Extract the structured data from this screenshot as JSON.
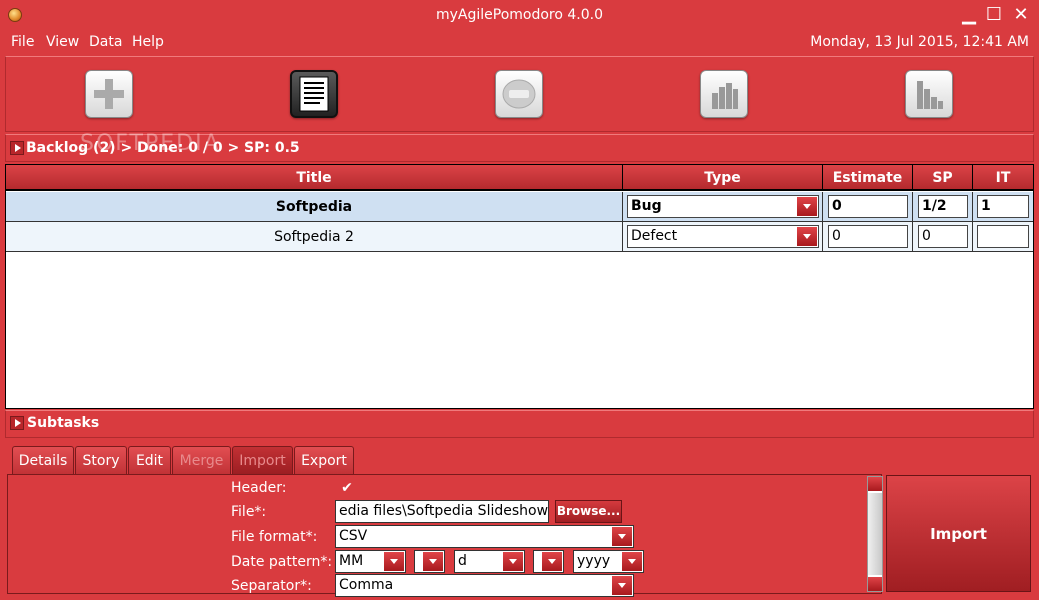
{
  "window": {
    "title": "myAgilePomodoro 4.0.0"
  },
  "menu": {
    "file": "File",
    "view": "View",
    "data": "Data",
    "help": "Help"
  },
  "datetime": "Monday, 13 Jul 2015, 12:41 AM",
  "watermark": "SOFTPEDIA",
  "backlog": {
    "header": "Backlog (2) > Done: 0 / 0 > SP: 0.5"
  },
  "table": {
    "columns": [
      "Title",
      "Type",
      "Estimate",
      "SP",
      "IT"
    ],
    "rows": [
      {
        "title": "Softpedia",
        "type": "Bug",
        "estimate": "0",
        "sp": "1/2",
        "it": "1"
      },
      {
        "title": "Softpedia 2",
        "type": "Defect",
        "estimate": "0",
        "sp": "0",
        "it": ""
      }
    ]
  },
  "subtasks": {
    "header": "Subtasks"
  },
  "tabs": [
    "Details",
    "Story",
    "Edit",
    "Merge",
    "Import",
    "Export"
  ],
  "import_form": {
    "header_label": "Header:",
    "header_checked": "✔",
    "file_label": "File*:",
    "file_value": "edia files\\Softpedia Slideshow.avi",
    "browse": "Browse...",
    "format_label": "File format*:",
    "format_value": "CSV",
    "date_label": "Date pattern*:",
    "date_parts": [
      "MM",
      "",
      "d",
      "",
      "yyyy"
    ],
    "separator_label": "Separator*:",
    "separator_value": "Comma"
  },
  "import_button": "Import"
}
